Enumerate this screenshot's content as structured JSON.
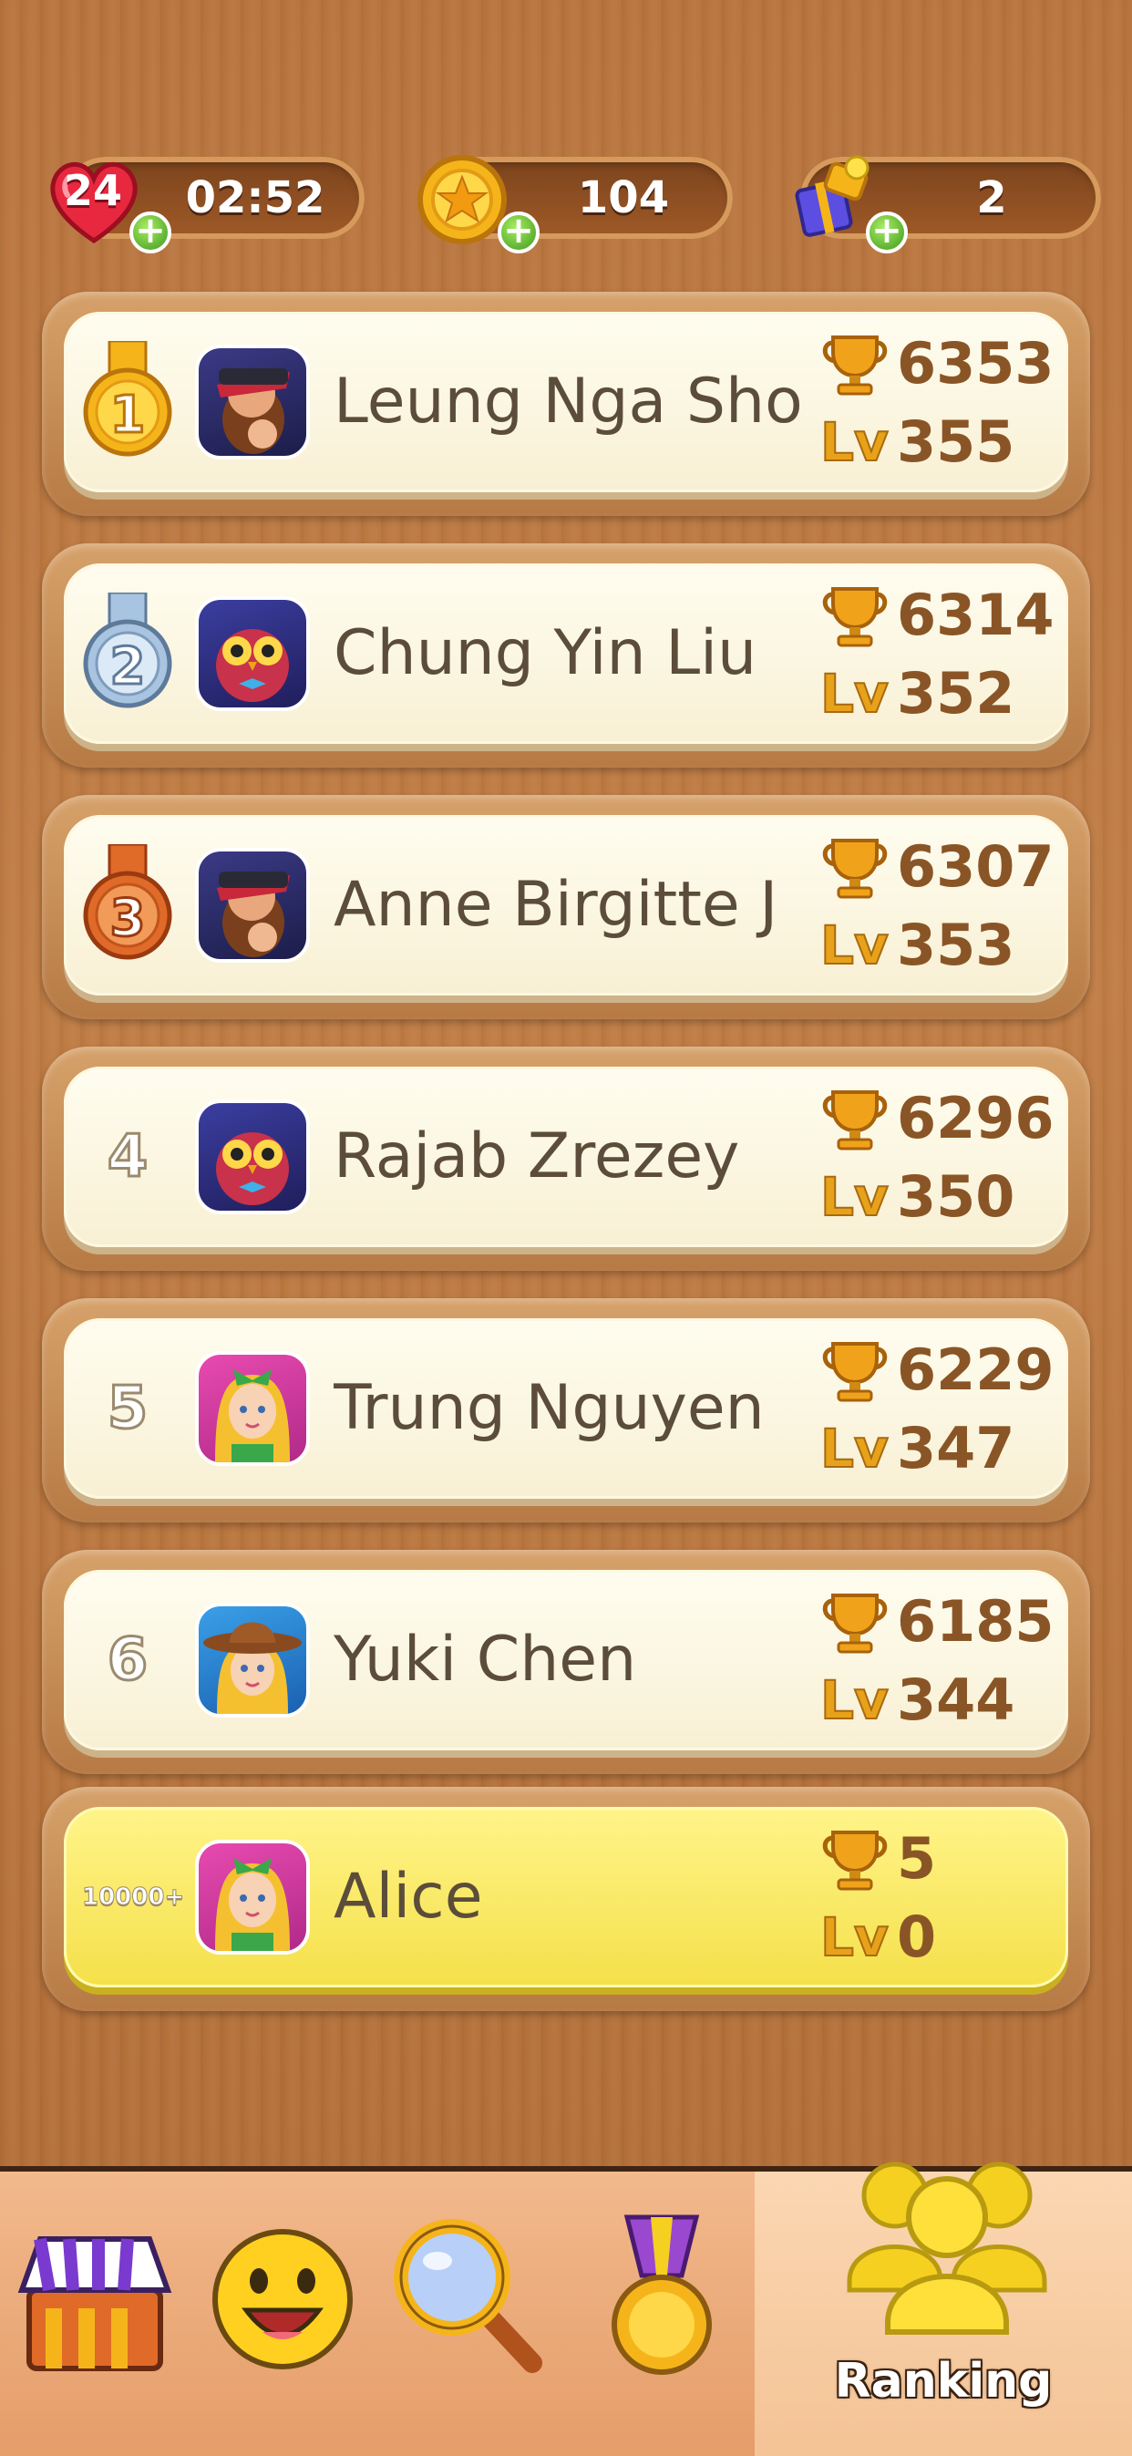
{
  "status": {
    "lives": "24",
    "timer": "02:52",
    "coins": "104",
    "gifts": "2",
    "plus_symbol": "+"
  },
  "ranking": [
    {
      "rank": "1",
      "name": "Leung Nga Sho",
      "score": "6353",
      "level": "355",
      "avatar": "pirate"
    },
    {
      "rank": "2",
      "name": "Chung Yin Liu",
      "score": "6314",
      "level": "352",
      "avatar": "owl"
    },
    {
      "rank": "3",
      "name": "Anne Birgitte J",
      "score": "6307",
      "level": "353",
      "avatar": "pirate"
    },
    {
      "rank": "4",
      "name": "Rajab Zrezey",
      "score": "6296",
      "level": "350",
      "avatar": "owl"
    },
    {
      "rank": "5",
      "name": "Trung Nguyen",
      "score": "6229",
      "level": "347",
      "avatar": "alice"
    },
    {
      "rank": "6",
      "name": "Yuki Chen",
      "score": "6185",
      "level": "344",
      "avatar": "cowgirl"
    }
  ],
  "me": {
    "rank": "10000+",
    "name": "Alice",
    "score": "5",
    "level": "0",
    "avatar": "alice"
  },
  "lv_label": "Lv",
  "nav": {
    "items": [
      "shop-icon",
      "smiley-icon",
      "magnifier-icon",
      "medal-icon",
      "ranking-icon"
    ],
    "active_label": "Ranking"
  },
  "colors": {
    "wood": "#b8743e",
    "card": "#fffdf0",
    "me_card": "#f5e04a",
    "gold": "#e8a21a",
    "silver": "#a9c4e0",
    "bronze": "#e06a28",
    "nav_bg": "#e59d6a"
  }
}
